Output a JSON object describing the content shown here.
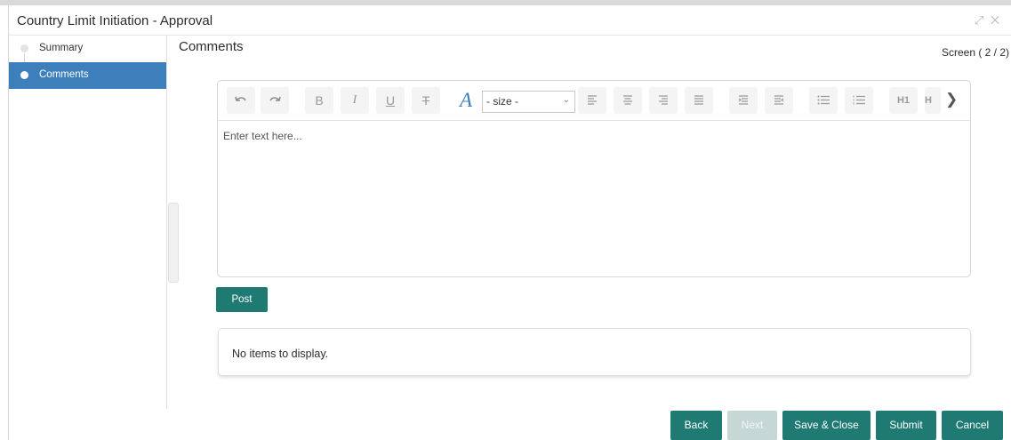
{
  "window": {
    "title": "Country Limit Initiation - Approval",
    "controls": [
      "expand-icon",
      "close-icon"
    ]
  },
  "sidebar": {
    "items": [
      {
        "label": "Summary",
        "active": false
      },
      {
        "label": "Comments",
        "active": true
      }
    ]
  },
  "main": {
    "title": "Comments",
    "screen_info": "Screen ( 2 / 2)"
  },
  "editor": {
    "toolbar": {
      "bold": "B",
      "italic": "I",
      "underline": "U",
      "strikethrough": "T",
      "font_color": "A",
      "size_select": "- size -",
      "heading1": "H1",
      "heading_partial": "H"
    },
    "placeholder": "Enter text here..."
  },
  "post_button": "Post",
  "items_list": {
    "empty_text": "No items to display."
  },
  "footer": {
    "back": "Back",
    "next": "Next",
    "save_close": "Save & Close",
    "submit": "Submit",
    "cancel": "Cancel"
  },
  "colors": {
    "accent": "#1f7a73",
    "sidebar_active": "#3d7fbb",
    "disabled": "#c6d8d6"
  }
}
